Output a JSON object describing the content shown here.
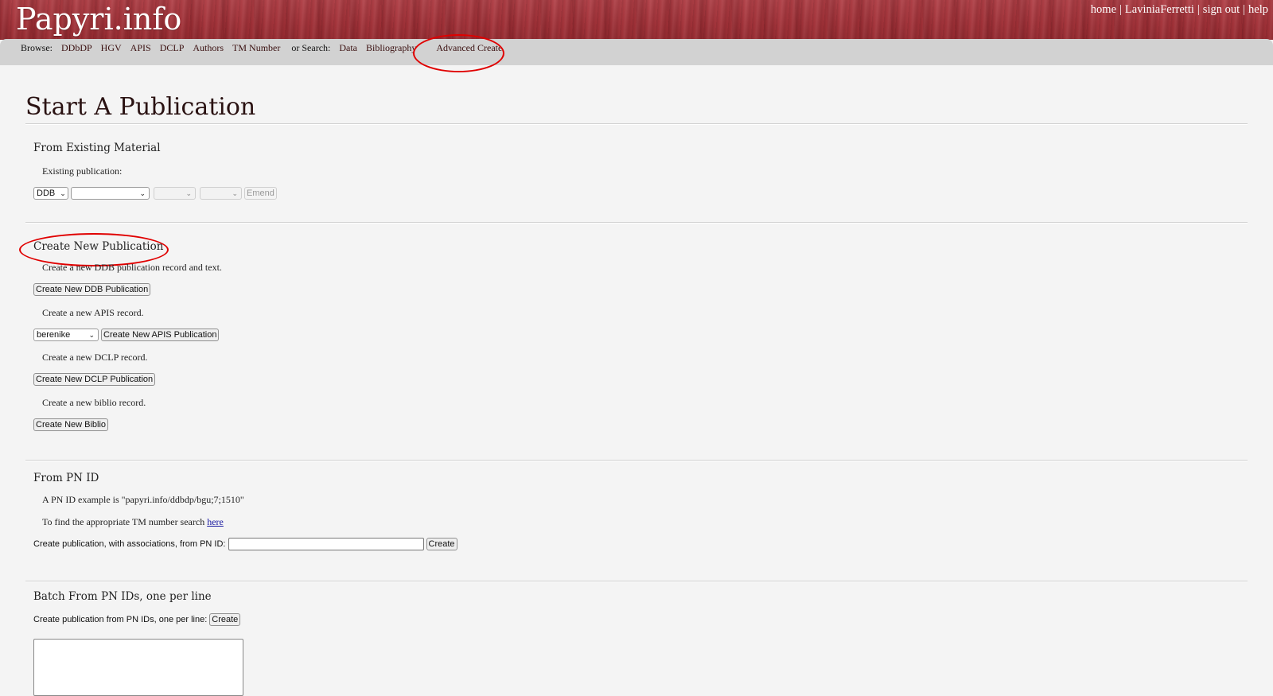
{
  "header": {
    "logo": "Papyri.info",
    "links": [
      {
        "label": "home"
      },
      {
        "label": "LaviniaFerretti"
      },
      {
        "label": "sign out"
      },
      {
        "label": "help"
      }
    ],
    "separator": "|"
  },
  "nav": {
    "browse_label": "Browse:",
    "browse_items": [
      "DDbDP",
      "HGV",
      "APIS",
      "DCLP",
      "Authors",
      "TM Number"
    ],
    "search_label": "or Search:",
    "search_items": [
      "Data",
      "Bibliography"
    ],
    "advanced": "Advanced Create"
  },
  "page": {
    "title": "Start A Publication"
  },
  "existing": {
    "heading": "From Existing Material",
    "label": "Existing publication:",
    "collection_value": "DDB",
    "volume_value": "",
    "document_value": "",
    "extra_value": "",
    "emend_button": "Emend"
  },
  "create_new": {
    "heading": "Create New Publication",
    "ddb_text": "Create a new DDB publication record and text.",
    "ddb_button": "Create New DDB Publication",
    "apis_text": "Create a new APIS record.",
    "apis_collection": "berenike",
    "apis_button": "Create New APIS Publication",
    "dclp_text": "Create a new DCLP record.",
    "dclp_button": "Create New DCLP Publication",
    "biblio_text": "Create a new biblio record.",
    "biblio_button": "Create New Biblio"
  },
  "pn_id": {
    "heading": "From PN ID",
    "example": "A PN ID example is \"papyri.info/ddbdp/bgu;7;1510\"",
    "tm_text": "To find the appropriate TM number search",
    "tm_link": "here",
    "field_label": "Create publication, with associations, from PN ID:",
    "field_value": "",
    "create_button": "Create"
  },
  "batch": {
    "heading": "Batch From PN IDs, one per line",
    "field_label": "Create publication from PN IDs, one per line:",
    "create_button": "Create",
    "textarea_value": ""
  },
  "colors": {
    "header_red": "#a5353c",
    "nav_gray": "#d2d2d2",
    "annotation_red": "#e00000",
    "background": "#f4f4f4"
  }
}
